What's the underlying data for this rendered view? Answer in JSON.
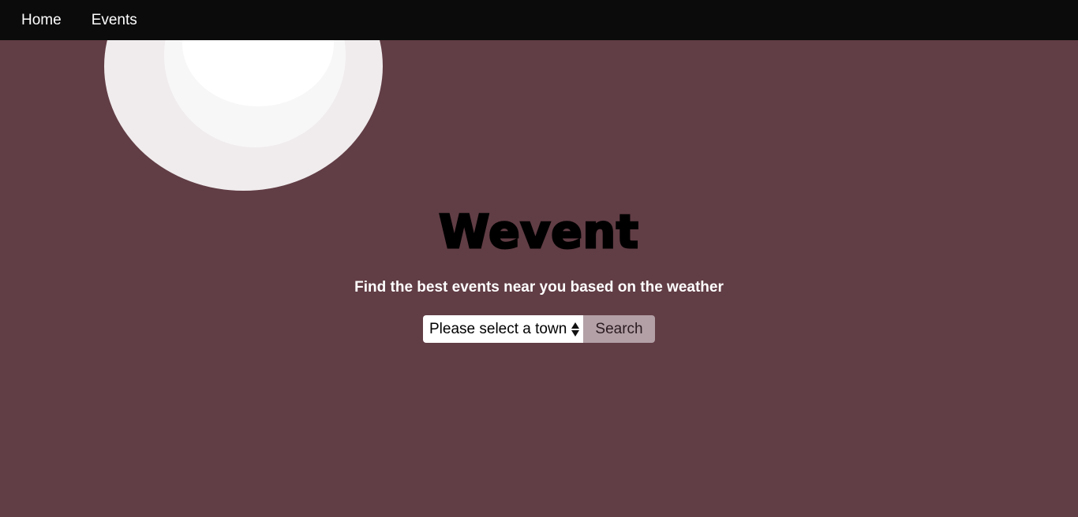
{
  "nav": {
    "items": [
      {
        "label": "Home"
      },
      {
        "label": "Events"
      }
    ]
  },
  "hero": {
    "brand": "Wevent",
    "tagline": "Find the best events near you based on the weather"
  },
  "search": {
    "town_select_value": "Please select a town",
    "button_label": "Search"
  },
  "colors": {
    "background": "#613d45",
    "navbar": "#0b0b0b",
    "sun_outer": "#f0eced",
    "sun_middle": "#f8f7f7",
    "sun_inner": "#ffffff",
    "search_button": "#b2a0a6"
  },
  "icons": {
    "sun": "sun-icon",
    "select_arrows": "select-arrows-icon"
  }
}
